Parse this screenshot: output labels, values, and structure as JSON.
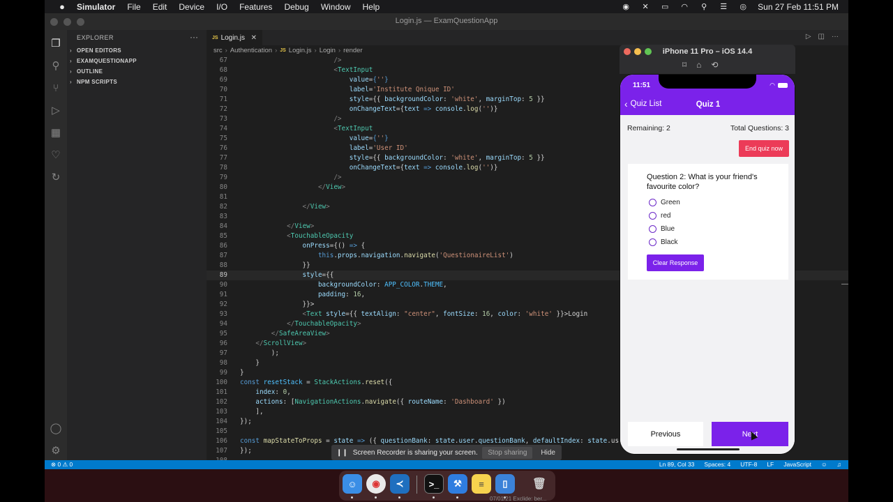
{
  "menubar": {
    "apple": "",
    "app": "Simulator",
    "items": [
      "File",
      "Edit",
      "Device",
      "I/O",
      "Features",
      "Debug",
      "Window",
      "Help"
    ],
    "clock": "Sun 27 Feb  11:51 PM"
  },
  "vscode": {
    "window_title": "Login.js — ExamQuestionApp",
    "explorer_title": "EXPLORER",
    "explorer_more": "···",
    "sections": [
      "OPEN EDITORS",
      "EXAMQUESTIONAPP",
      "OUTLINE",
      "NPM SCRIPTS"
    ],
    "tab": {
      "icon": "JS",
      "label": "Login.js",
      "close": "✕"
    },
    "breadcrumb": [
      "src",
      "Authentication",
      "Login.js",
      "Login",
      "render"
    ],
    "status": {
      "left": "⊗ 0 ⚠ 0",
      "position": "Ln 89, Col 33",
      "spaces": "Spaces: 4",
      "encoding": "UTF-8",
      "eol": "LF",
      "language": "JavaScript"
    },
    "code_lines": [
      {
        "n": "67",
        "s": [
          [
            "t-punc",
            "                        />"
          ]
        ]
      },
      {
        "n": "68",
        "s": [
          [
            "t-punc",
            "                        <"
          ],
          [
            "t-tag",
            "TextInput"
          ]
        ]
      },
      {
        "n": "69",
        "s": [
          [
            "t-attr",
            "                            value"
          ],
          [
            "",
            "="
          ],
          [
            "t-kw",
            "{"
          ],
          [
            "t-str",
            "''"
          ],
          [
            "t-kw",
            "}"
          ]
        ]
      },
      {
        "n": "70",
        "s": [
          [
            "t-attr",
            "                            label"
          ],
          [
            "",
            "="
          ],
          [
            "t-str",
            "'Institute Qnique ID'"
          ]
        ]
      },
      {
        "n": "71",
        "s": [
          [
            "t-attr",
            "                            style"
          ],
          [
            "",
            "={{ "
          ],
          [
            "t-attr",
            "backgroundColor"
          ],
          [
            "",
            ": "
          ],
          [
            "t-str",
            "'white'"
          ],
          [
            "",
            ", "
          ],
          [
            "t-attr",
            "marginTop"
          ],
          [
            "",
            ": "
          ],
          [
            "t-num",
            "5"
          ],
          [
            "",
            " }}"
          ]
        ]
      },
      {
        "n": "72",
        "s": [
          [
            "t-attr",
            "                            onChangeText"
          ],
          [
            "",
            "={"
          ],
          [
            "t-attr",
            "text"
          ],
          [
            "t-kw",
            " => "
          ],
          [
            "t-attr",
            "console"
          ],
          [
            "",
            "."
          ],
          [
            "t-fn",
            "log"
          ],
          [
            "",
            "("
          ],
          [
            "t-str",
            "''"
          ],
          [
            "",
            ")}"
          ]
        ]
      },
      {
        "n": "73",
        "s": [
          [
            "t-punc",
            "                        />"
          ]
        ]
      },
      {
        "n": "74",
        "s": [
          [
            "t-punc",
            "                        <"
          ],
          [
            "t-tag",
            "TextInput"
          ]
        ]
      },
      {
        "n": "75",
        "s": [
          [
            "t-attr",
            "                            value"
          ],
          [
            "",
            "="
          ],
          [
            "t-kw",
            "{"
          ],
          [
            "t-str",
            "''"
          ],
          [
            "t-kw",
            "}"
          ]
        ]
      },
      {
        "n": "76",
        "s": [
          [
            "t-attr",
            "                            label"
          ],
          [
            "",
            "="
          ],
          [
            "t-str",
            "'User ID'"
          ]
        ]
      },
      {
        "n": "77",
        "s": [
          [
            "t-attr",
            "                            style"
          ],
          [
            "",
            "={{ "
          ],
          [
            "t-attr",
            "backgroundColor"
          ],
          [
            "",
            ": "
          ],
          [
            "t-str",
            "'white'"
          ],
          [
            "",
            ", "
          ],
          [
            "t-attr",
            "marginTop"
          ],
          [
            "",
            ": "
          ],
          [
            "t-num",
            "5"
          ],
          [
            "",
            " }}"
          ]
        ]
      },
      {
        "n": "78",
        "s": [
          [
            "t-attr",
            "                            onChangeText"
          ],
          [
            "",
            "={"
          ],
          [
            "t-attr",
            "text"
          ],
          [
            "t-kw",
            " => "
          ],
          [
            "t-attr",
            "console"
          ],
          [
            "",
            "."
          ],
          [
            "t-fn",
            "log"
          ],
          [
            "",
            "("
          ],
          [
            "t-str",
            "''"
          ],
          [
            "",
            ")}"
          ]
        ]
      },
      {
        "n": "79",
        "s": [
          [
            "t-punc",
            "                        />"
          ]
        ]
      },
      {
        "n": "80",
        "s": [
          [
            "t-punc",
            "                    </"
          ],
          [
            "t-tag",
            "View"
          ],
          [
            "t-punc",
            ">"
          ]
        ]
      },
      {
        "n": "81",
        "s": []
      },
      {
        "n": "82",
        "s": [
          [
            "t-punc",
            "                </"
          ],
          [
            "t-tag",
            "View"
          ],
          [
            "t-punc",
            ">"
          ]
        ]
      },
      {
        "n": "83",
        "s": []
      },
      {
        "n": "84",
        "s": [
          [
            "t-punc",
            "            </"
          ],
          [
            "t-tag",
            "View"
          ],
          [
            "t-punc",
            ">"
          ]
        ]
      },
      {
        "n": "85",
        "s": [
          [
            "t-punc",
            "            <"
          ],
          [
            "t-tag",
            "TouchableOpacity"
          ]
        ]
      },
      {
        "n": "86",
        "s": [
          [
            "t-attr",
            "                onPress"
          ],
          [
            "",
            "={() "
          ],
          [
            "t-kw",
            "=>"
          ],
          [
            "",
            " {"
          ]
        ]
      },
      {
        "n": "87",
        "s": [
          [
            "t-kw",
            "                    this"
          ],
          [
            "",
            "."
          ],
          [
            "t-attr",
            "props"
          ],
          [
            "",
            "."
          ],
          [
            "t-attr",
            "navigation"
          ],
          [
            "",
            "."
          ],
          [
            "t-fn",
            "navigate"
          ],
          [
            "",
            "("
          ],
          [
            "t-str",
            "'QuestionaireList'"
          ],
          [
            "",
            ")"
          ]
        ]
      },
      {
        "n": "88",
        "s": [
          [
            "",
            "                }}"
          ]
        ]
      },
      {
        "n": "89",
        "s": [
          [
            "t-attr",
            "                style"
          ],
          [
            "",
            "={{"
          ]
        ]
      },
      {
        "n": "90",
        "s": [
          [
            "t-attr",
            "                    backgroundColor"
          ],
          [
            "",
            ": "
          ],
          [
            "t-const",
            "APP_COLOR"
          ],
          [
            "",
            "."
          ],
          [
            "t-const",
            "THEME"
          ],
          [
            "",
            ","
          ]
        ]
      },
      {
        "n": "91",
        "s": [
          [
            "t-attr",
            "                    padding"
          ],
          [
            "",
            ": "
          ],
          [
            "t-num",
            "16"
          ],
          [
            "",
            ","
          ]
        ]
      },
      {
        "n": "92",
        "s": [
          [
            "",
            "                }}>"
          ]
        ]
      },
      {
        "n": "93",
        "s": [
          [
            "t-punc",
            "                <"
          ],
          [
            "t-tag",
            "Text"
          ],
          [
            "",
            " "
          ],
          [
            "t-attr",
            "style"
          ],
          [
            "",
            "={{ "
          ],
          [
            "t-attr",
            "textAlign"
          ],
          [
            "",
            ": "
          ],
          [
            "t-str",
            "\"center\""
          ],
          [
            "",
            ", "
          ],
          [
            "t-attr",
            "fontSize"
          ],
          [
            "",
            ": "
          ],
          [
            "t-num",
            "16"
          ],
          [
            "",
            ", "
          ],
          [
            "t-attr",
            "color"
          ],
          [
            "",
            ": "
          ],
          [
            "t-str",
            "'white'"
          ],
          [
            "",
            " }}>Login"
          ]
        ]
      },
      {
        "n": "94",
        "s": [
          [
            "t-punc",
            "            </"
          ],
          [
            "t-tag",
            "TouchableOpacity"
          ],
          [
            "t-punc",
            ">"
          ]
        ]
      },
      {
        "n": "95",
        "s": [
          [
            "t-punc",
            "        </"
          ],
          [
            "t-tag",
            "SafeAreaView"
          ],
          [
            "t-punc",
            ">"
          ]
        ]
      },
      {
        "n": "96",
        "s": [
          [
            "t-punc",
            "    </"
          ],
          [
            "t-tag",
            "ScrollView"
          ],
          [
            "t-punc",
            ">"
          ]
        ]
      },
      {
        "n": "97",
        "s": [
          [
            "",
            "        );"
          ]
        ]
      },
      {
        "n": "98",
        "s": [
          [
            "",
            "    }"
          ]
        ]
      },
      {
        "n": "99",
        "s": [
          [
            "",
            "}"
          ]
        ]
      },
      {
        "n": "100",
        "s": [
          [
            "t-kw",
            "const "
          ],
          [
            "t-const",
            "resetStack"
          ],
          [
            "",
            " = "
          ],
          [
            "t-tag",
            "StackActions"
          ],
          [
            "",
            "."
          ],
          [
            "t-fn",
            "reset"
          ],
          [
            "",
            "({"
          ]
        ]
      },
      {
        "n": "101",
        "s": [
          [
            "t-attr",
            "    index"
          ],
          [
            "",
            ": "
          ],
          [
            "t-num",
            "0"
          ],
          [
            "",
            ","
          ]
        ]
      },
      {
        "n": "102",
        "s": [
          [
            "t-attr",
            "    actions"
          ],
          [
            "",
            ": ["
          ],
          [
            "t-tag",
            "NavigationActions"
          ],
          [
            "",
            "."
          ],
          [
            "t-fn",
            "navigate"
          ],
          [
            "",
            "({ "
          ],
          [
            "t-attr",
            "routeName"
          ],
          [
            "",
            ": "
          ],
          [
            "t-str",
            "'Dashboard'"
          ],
          [
            "",
            " })"
          ]
        ]
      },
      {
        "n": "103",
        "s": [
          [
            "",
            "    ],"
          ]
        ]
      },
      {
        "n": "104",
        "s": [
          [
            "",
            "});"
          ]
        ]
      },
      {
        "n": "105",
        "s": []
      },
      {
        "n": "106",
        "s": [
          [
            "t-kw",
            "const "
          ],
          [
            "t-fn",
            "mapStateToProps"
          ],
          [
            "",
            " = "
          ],
          [
            "t-attr",
            "state"
          ],
          [
            "t-kw",
            " => "
          ],
          [
            "",
            "({ "
          ],
          [
            "t-attr",
            "questionBank"
          ],
          [
            "",
            ": "
          ],
          [
            "t-attr",
            "state"
          ],
          [
            "",
            "."
          ],
          [
            "t-attr",
            "user"
          ],
          [
            "",
            "."
          ],
          [
            "t-attr",
            "questionBank"
          ],
          [
            "",
            ", "
          ],
          [
            "t-attr",
            "defaultIndex"
          ],
          [
            "",
            ": "
          ],
          [
            "t-attr",
            "state"
          ],
          [
            "",
            ".us"
          ]
        ]
      },
      {
        "n": "107",
        "s": [
          [
            "",
            "});"
          ]
        ]
      },
      {
        "n": "108",
        "s": []
      }
    ]
  },
  "simulator": {
    "device_title": "iPhone 11 Pro – iOS 14.4",
    "clock": "11:51",
    "nav_back": "Quiz List",
    "nav_title": "Quiz 1",
    "remaining": "Remaining: 2",
    "total": "Total Questions: 3",
    "end_button": "End quiz now",
    "question": "Question 2: What is your friend's favourite color?",
    "options": [
      "Green",
      "red",
      "Blue",
      "Black"
    ],
    "clear_button": "Clear Response",
    "prev_button": "Previous",
    "next_button": "Next"
  },
  "sharebar": {
    "message": "Screen Recorder is sharing your screen.",
    "stop": "Stop sharing",
    "hide": "Hide"
  },
  "dock": {
    "ghost_text": "07/01/21  Exclide: ber..."
  },
  "colors": {
    "accent": "#7b22ea",
    "danger": "#ec3b58",
    "vscode_status": "#007acc"
  }
}
